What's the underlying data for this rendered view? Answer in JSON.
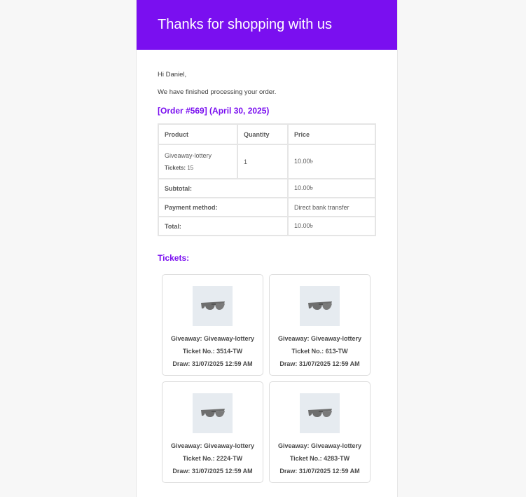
{
  "header": {
    "title": "Thanks for shopping with us"
  },
  "greeting": "Hi Daniel,",
  "message": "We have finished processing your order.",
  "order_title": "[Order #569] (April 30, 2025)",
  "table": {
    "headers": [
      "Product",
      "Quantity",
      "Price"
    ],
    "item": {
      "product": "Giveaway-lottery",
      "tickets_label": "Tickets:",
      "tickets_value": "15",
      "quantity": "1",
      "price": "10.00৳"
    },
    "subtotal_label": "Subtotal:",
    "subtotal_value": "10.00৳",
    "payment_label": "Payment method:",
    "payment_value": "Direct bank transfer",
    "total_label": "Total:",
    "total_value": "10.00৳"
  },
  "tickets_title": "Tickets:",
  "tickets": [
    {
      "giveaway": "Giveaway: Giveaway-lottery",
      "ticket_no": "Ticket No.: 3514-TW",
      "draw": "Draw: 31/07/2025 12:59 AM",
      "image_icon": "sunglasses-icon"
    },
    {
      "giveaway": "Giveaway: Giveaway-lottery",
      "ticket_no": "Ticket No.: 613-TW",
      "draw": "Draw: 31/07/2025 12:59 AM",
      "image_icon": "sunglasses-icon"
    },
    {
      "giveaway": "Giveaway: Giveaway-lottery",
      "ticket_no": "Ticket No.: 2224-TW",
      "draw": "Draw: 31/07/2025 12:59 AM",
      "image_icon": "sunglasses-icon"
    },
    {
      "giveaway": "Giveaway: Giveaway-lottery",
      "ticket_no": "Ticket No.: 4283-TW",
      "draw": "Draw: 31/07/2025 12:59 AM",
      "image_icon": "sunglasses-icon"
    }
  ],
  "colors": {
    "accent": "#7a0ff0",
    "background": "#f7f7f7",
    "card_border": "#dcdcdc"
  }
}
